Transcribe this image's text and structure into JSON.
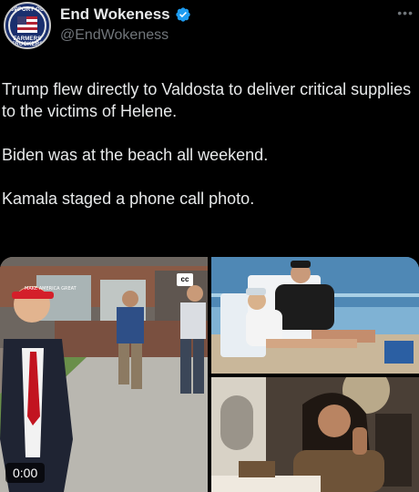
{
  "author": {
    "display_name": "End Wokeness",
    "handle": "@EndWokeness",
    "avatar_text_top": "SUPPORT OUR",
    "avatar_text_bottom": "FARMERS TRUCKERS",
    "verified_color": "#1d9bf0"
  },
  "tweet": {
    "lines": [
      "Trump flew directly to Valdosta to deliver critical supplies to the victims of Helene.",
      "Biden was at the beach all weekend.",
      "Kamala staged a phone call photo."
    ]
  },
  "media": {
    "video_duration": "0:00",
    "cc_label": "cc",
    "hat_text": "MAKE AMERICA GREAT"
  },
  "icons": {
    "verified": "verified-badge-icon",
    "more": "more-options-icon"
  }
}
